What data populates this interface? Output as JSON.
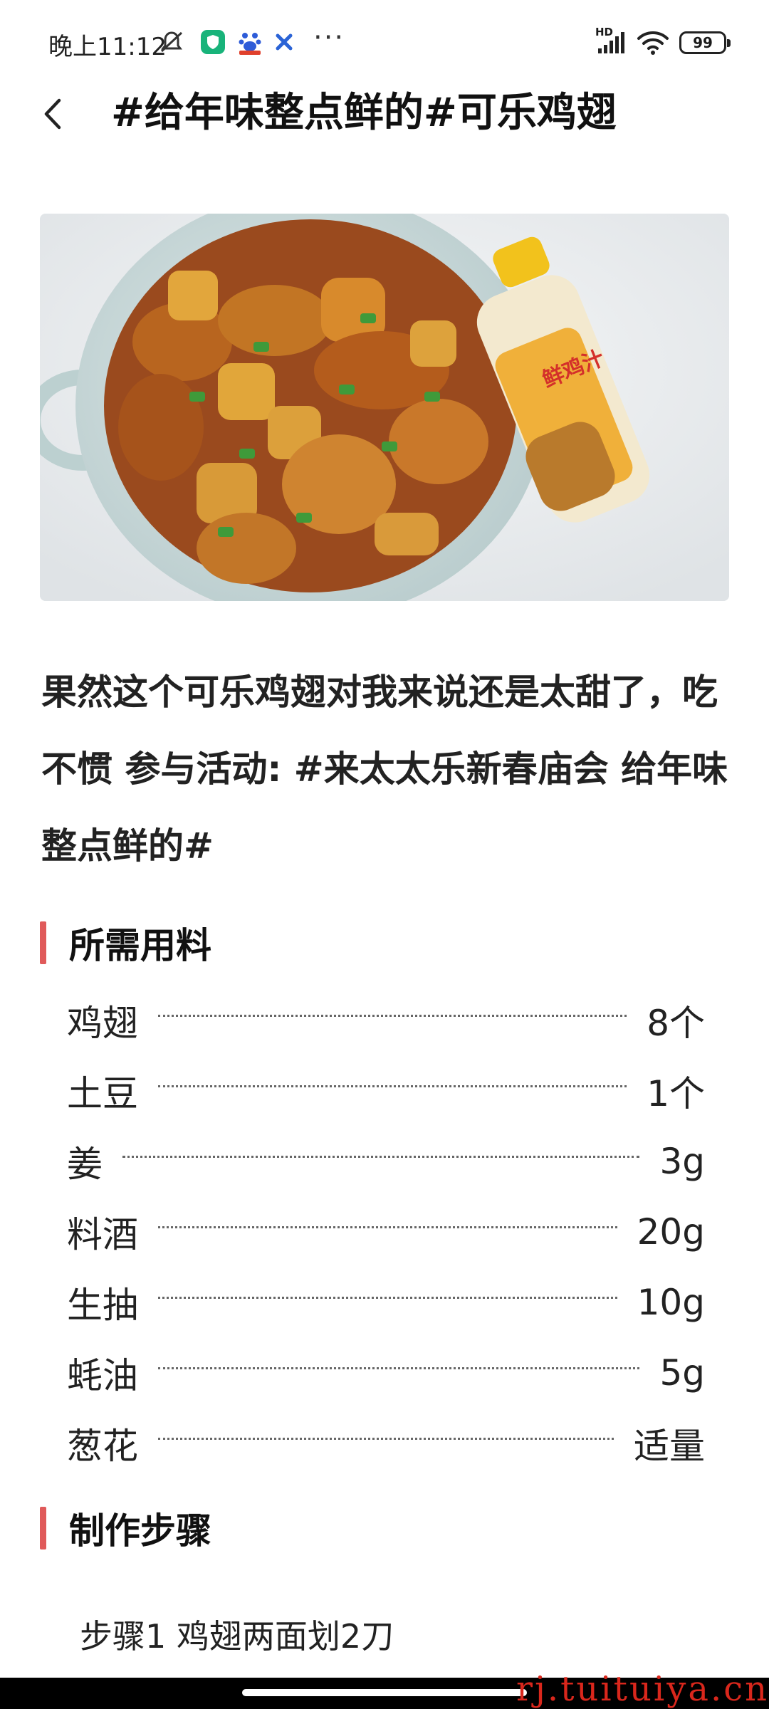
{
  "status_bar": {
    "time": "晚上11:12",
    "network": "HD",
    "battery": "99",
    "more": "···"
  },
  "header": {
    "title": "#给年味整点鲜的#可乐鸡翅"
  },
  "post": {
    "description": "果然这个可乐鸡翅对我来说还是太甜了，吃不惯 参与活动: #来太太乐新春庙会 给年味整点鲜的#",
    "image_label": "鲜鸡汁"
  },
  "ingredients": {
    "title": "所需用料",
    "items": [
      {
        "name": "鸡翅",
        "qty": "8个"
      },
      {
        "name": "土豆",
        "qty": "1个"
      },
      {
        "name": "姜",
        "qty": "3g"
      },
      {
        "name": "料酒",
        "qty": "20g"
      },
      {
        "name": "生抽",
        "qty": "10g"
      },
      {
        "name": "蚝油",
        "qty": "5g"
      },
      {
        "name": "葱花",
        "qty": "适量"
      }
    ]
  },
  "steps": {
    "title": "制作步骤",
    "items": [
      {
        "text": "步骤1 鸡翅两面划2刀"
      }
    ]
  },
  "watermark": "rj.tuituiya.cn",
  "colors": {
    "accent": "#e05a5a",
    "watermark": "#d9271c"
  }
}
